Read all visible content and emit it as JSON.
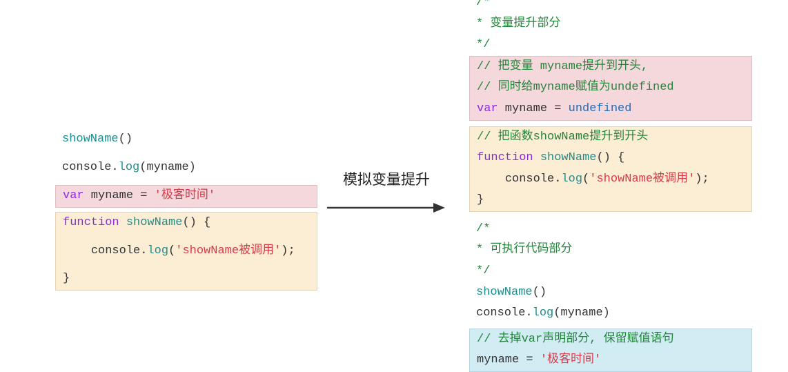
{
  "arrow_label": "模拟变量提升",
  "left": {
    "l1_call": "showName",
    "l1_paren": "()",
    "l2_obj": "console",
    "l2_dot": ".",
    "l2_m": "log",
    "l2_open": "(",
    "l2_arg": "myname",
    "l2_close": ")",
    "l3_var": "var",
    "l3_name": " myname ",
    "l3_eq": "= ",
    "l3_str": "'极客时间'",
    "l4_func": "function",
    "l4_name": " showName",
    "l4_paren": "()",
    "l4_brace": " {",
    "l5_pad": "    ",
    "l5_obj": "console",
    "l5_dot": ".",
    "l5_m": "log",
    "l5_open": "(",
    "l5_str": "'showName被调用'",
    "l5_close": ");",
    "l6": "}"
  },
  "right": {
    "c1a": "/*",
    "c1b": "* 变量提升部分",
    "c1c": "*/",
    "pink1": "// 把变量 myname提升到开头,",
    "pink2": "// 同时给myname赋值为undefined",
    "pink3_var": "var",
    "pink3_name": " myname ",
    "pink3_eq": "= ",
    "pink3_undef": "undefined",
    "orange1": "// 把函数showName提升到开头",
    "orange2_func": "function",
    "orange2_name": " showName",
    "orange2_paren": "()",
    "orange2_brace": " {",
    "orange3_pad": "    ",
    "orange3_obj": "console",
    "orange3_dot": ".",
    "orange3_m": "log",
    "orange3_open": "(",
    "orange3_str": "'showName被调用'",
    "orange3_close": ");",
    "orange4": "}",
    "c2a": "/*",
    "c2b": "* 可执行代码部分",
    "c2c": "*/",
    "exec1_call": "showName",
    "exec1_paren": "()",
    "exec2_obj": "console",
    "exec2_dot": ".",
    "exec2_m": "log",
    "exec2_open": "(",
    "exec2_arg": "myname",
    "exec2_close": ")",
    "blue1": "// 去掉var声明部分, 保留赋值语句",
    "blue2_name": "myname ",
    "blue2_eq": "= ",
    "blue2_str": "'极客时间'"
  }
}
